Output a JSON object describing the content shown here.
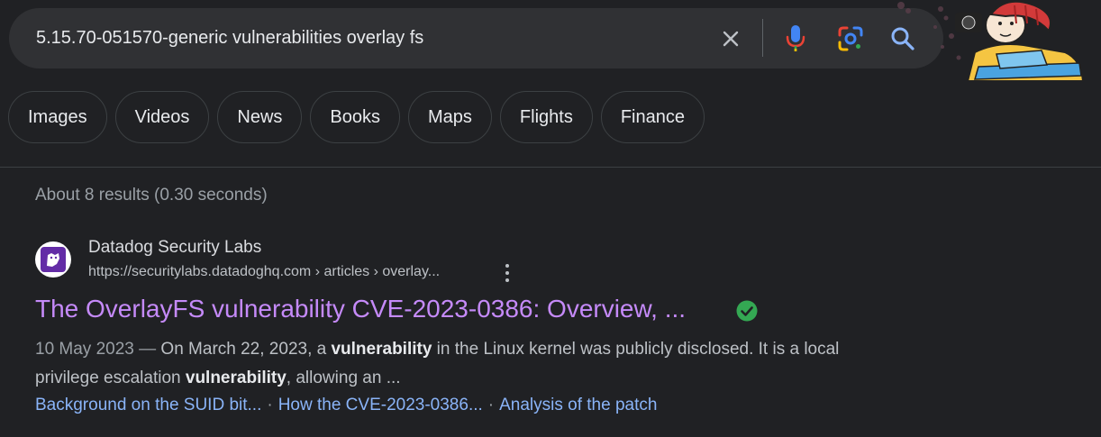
{
  "search": {
    "query": "5.15.70-051570-generic vulnerabilities overlay fs",
    "icons": [
      "close-icon",
      "microphone-icon",
      "google-lens-icon",
      "search-icon"
    ]
  },
  "chips": [
    "Images",
    "Videos",
    "News",
    "Books",
    "Maps",
    "Flights",
    "Finance"
  ],
  "stats": "About 8 results (0.30 seconds)",
  "result": {
    "site_name": "Datadog Security Labs",
    "url": "https://securitylabs.datadoghq.com › articles › overlay...",
    "title": "The OverlayFS vulnerability CVE-2023-0386: Overview, ...",
    "date": "10 May 2023",
    "date_sep": " — ",
    "snippet_1": "On March 22, 2023, a ",
    "snippet_bold_1": "vulnerability",
    "snippet_2": " in the Linux kernel was publicly disclosed. It is a local privilege escalation ",
    "snippet_bold_2": "vulnerability",
    "snippet_3": ", allowing an ...",
    "sitelinks": [
      "Background on the SUID bit...",
      "How the CVE-2023-0386...",
      "Analysis of the patch"
    ],
    "sitelink_separator": "·"
  },
  "colors": {
    "background": "#202124",
    "title_visited": "#c58af9",
    "link": "#8ab4f8",
    "verified": "#34a853"
  }
}
